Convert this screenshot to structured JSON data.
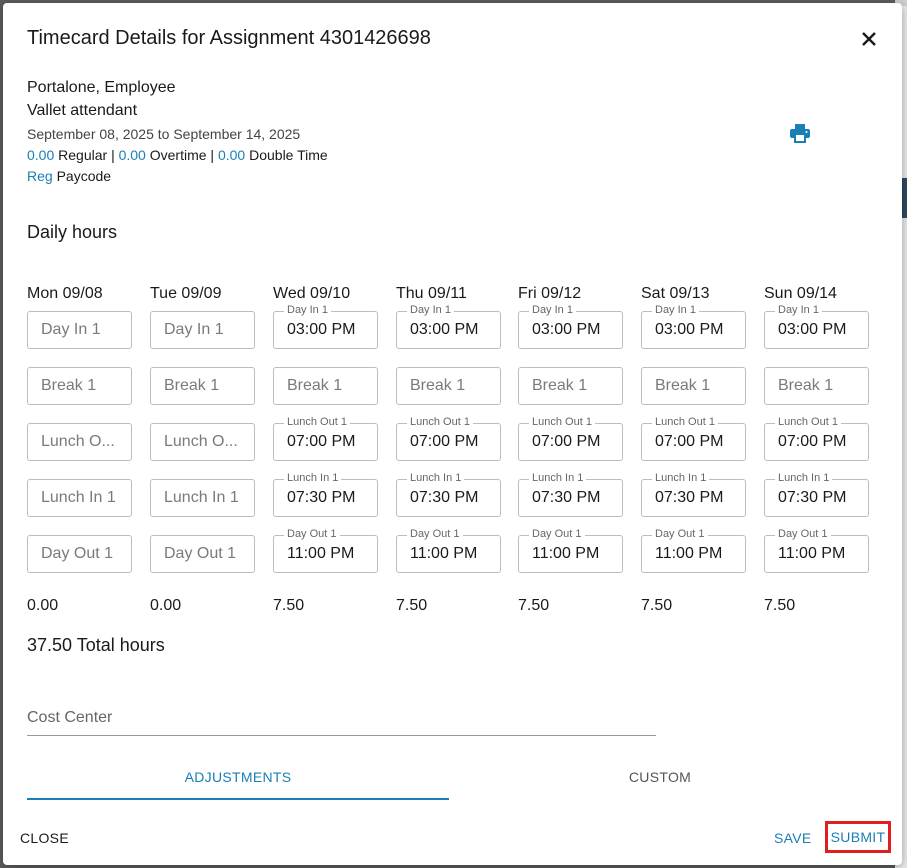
{
  "modal": {
    "title": "Timecard Details for Assignment 4301426698",
    "employee_name": "Portalone, Employee",
    "job_title": "Vallet attendant",
    "date_range": "September 08, 2025 to September 14, 2025",
    "hours": {
      "regular_value": "0.00",
      "regular_label": "Regular",
      "overtime_value": "0.00",
      "overtime_label": "Overtime",
      "double_value": "0.00",
      "double_label": "Double Time",
      "sep": "|"
    },
    "paycode": {
      "value": "Reg",
      "label": "Paycode"
    },
    "section_title": "Daily hours",
    "days": [
      {
        "header": "Mon 09/08",
        "total": "0.00",
        "fields": [
          {
            "label": "Day In 1",
            "value": ""
          },
          {
            "label": "Break 1",
            "value": ""
          },
          {
            "label": "Lunch O...",
            "value": ""
          },
          {
            "label": "Lunch In 1",
            "value": ""
          },
          {
            "label": "Day Out 1",
            "value": ""
          }
        ]
      },
      {
        "header": "Tue 09/09",
        "total": "0.00",
        "fields": [
          {
            "label": "Day In 1",
            "value": ""
          },
          {
            "label": "Break 1",
            "value": ""
          },
          {
            "label": "Lunch O...",
            "value": ""
          },
          {
            "label": "Lunch In 1",
            "value": ""
          },
          {
            "label": "Day Out 1",
            "value": ""
          }
        ]
      },
      {
        "header": "Wed 09/10",
        "total": "7.50",
        "fields": [
          {
            "label": "Day In 1",
            "value": "03:00 PM"
          },
          {
            "label": "Break 1",
            "value": ""
          },
          {
            "label": "Lunch Out 1",
            "value": "07:00 PM"
          },
          {
            "label": "Lunch In 1",
            "value": "07:30 PM"
          },
          {
            "label": "Day Out 1",
            "value": "11:00 PM"
          }
        ]
      },
      {
        "header": "Thu 09/11",
        "total": "7.50",
        "fields": [
          {
            "label": "Day In 1",
            "value": "03:00 PM"
          },
          {
            "label": "Break 1",
            "value": ""
          },
          {
            "label": "Lunch Out 1",
            "value": "07:00 PM"
          },
          {
            "label": "Lunch In 1",
            "value": "07:30 PM"
          },
          {
            "label": "Day Out 1",
            "value": "11:00 PM"
          }
        ]
      },
      {
        "header": "Fri 09/12",
        "total": "7.50",
        "fields": [
          {
            "label": "Day In 1",
            "value": "03:00 PM"
          },
          {
            "label": "Break 1",
            "value": ""
          },
          {
            "label": "Lunch Out 1",
            "value": "07:00 PM"
          },
          {
            "label": "Lunch In 1",
            "value": "07:30 PM"
          },
          {
            "label": "Day Out 1",
            "value": "11:00 PM"
          }
        ]
      },
      {
        "header": "Sat 09/13",
        "total": "7.50",
        "fields": [
          {
            "label": "Day In 1",
            "value": "03:00 PM"
          },
          {
            "label": "Break 1",
            "value": ""
          },
          {
            "label": "Lunch Out 1",
            "value": "07:00 PM"
          },
          {
            "label": "Lunch In 1",
            "value": "07:30 PM"
          },
          {
            "label": "Day Out 1",
            "value": "11:00 PM"
          }
        ]
      },
      {
        "header": "Sun 09/14",
        "total": "7.50",
        "fields": [
          {
            "label": "Day In 1",
            "value": "03:00 PM"
          },
          {
            "label": "Break 1",
            "value": ""
          },
          {
            "label": "Lunch Out 1",
            "value": "07:00 PM"
          },
          {
            "label": "Lunch In 1",
            "value": "07:30 PM"
          },
          {
            "label": "Day Out 1",
            "value": "11:00 PM"
          }
        ]
      }
    ],
    "total_hours": "37.50 Total hours",
    "cost_center_placeholder": "Cost Center",
    "tabs": [
      {
        "label": "ADJUSTMENTS",
        "active": true
      },
      {
        "label": "CUSTOM",
        "active": false
      }
    ],
    "buttons": {
      "close": "CLOSE",
      "save": "SAVE",
      "submit": "SUBMIT"
    }
  },
  "colors": {
    "accent": "#1a7fb5",
    "highlight": "#e01e1e"
  },
  "icons": {
    "close": "close-icon",
    "print": "print-icon"
  }
}
